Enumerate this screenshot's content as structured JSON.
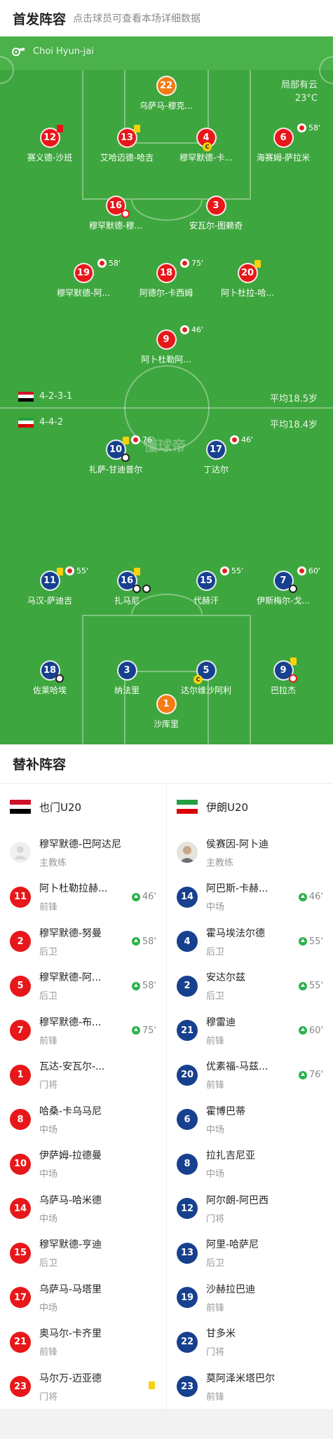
{
  "header": {
    "title": "首发阵容",
    "subtitle": "点击球员可查看本场详细数据"
  },
  "referee": {
    "name": "Choi Hyun-jai",
    "icon": "whistle-icon"
  },
  "weather": {
    "condition": "局部有云",
    "temperature": "23°C"
  },
  "watermark": "懂球帝",
  "home": {
    "name": "也门U20",
    "formation": "4-2-3-1",
    "avg_age": "平均18.5岁",
    "flag_colors": [
      "#ce1126",
      "#ffffff",
      "#000000"
    ],
    "players": [
      {
        "num": "22",
        "name": "乌萨马-穆克...",
        "color": "orange"
      },
      {
        "num": "12",
        "name": "赛义德-沙班"
      },
      {
        "num": "13",
        "name": "艾哈迈德-哈吉"
      },
      {
        "num": "4",
        "name": "穆罕默德-卡..."
      },
      {
        "num": "6",
        "name": "海赛姆-萨拉米",
        "sub_out": "58'"
      },
      {
        "num": "16",
        "name": "穆罕默德-穆..."
      },
      {
        "num": "3",
        "name": "安瓦尔-图赖奇"
      },
      {
        "num": "19",
        "name": "穆罕默德-阿...",
        "sub_out": "58'"
      },
      {
        "num": "18",
        "name": "阿德尔-卡西姆",
        "sub_out": "75'"
      },
      {
        "num": "20",
        "name": "阿卜杜拉-哈..."
      },
      {
        "num": "9",
        "name": "阿卜杜勒阿...",
        "sub_out": "46'"
      }
    ]
  },
  "away": {
    "name": "伊朗U20",
    "formation": "4-4-2",
    "avg_age": "平均18.4岁",
    "flag_colors": [
      "#239f40",
      "#ffffff",
      "#da0000"
    ],
    "players": [
      {
        "num": "10",
        "name": "礼萨-甘迪普尔",
        "sub_out": "76'"
      },
      {
        "num": "17",
        "name": "丁达尔",
        "sub_out": "46'"
      },
      {
        "num": "11",
        "name": "马汉-萨迪吉",
        "sub_out": "55'"
      },
      {
        "num": "16",
        "name": "扎马尼"
      },
      {
        "num": "15",
        "name": "代赫汗",
        "sub_out": "55'"
      },
      {
        "num": "7",
        "name": "伊斯梅尔-戈...",
        "sub_out": "60'"
      },
      {
        "num": "18",
        "name": "佐莱哈埃"
      },
      {
        "num": "3",
        "name": "纳法里"
      },
      {
        "num": "5",
        "name": "达尔维沙阿利"
      },
      {
        "num": "9",
        "name": "巴拉杰"
      },
      {
        "num": "1",
        "name": "沙库里",
        "color": "orange"
      }
    ]
  },
  "subs": {
    "title": "替补阵容",
    "home": {
      "team": "也门U20",
      "coach": {
        "name": "穆罕默德-巴阿达尼",
        "role": "主教练"
      },
      "players": [
        {
          "num": "11",
          "name": "阿卜杜勒拉赫...",
          "pos": "前锋",
          "in": "46'"
        },
        {
          "num": "2",
          "name": "穆罕默德-努曼",
          "pos": "后卫",
          "in": "58'"
        },
        {
          "num": "5",
          "name": "穆罕默德-阿...",
          "pos": "后卫",
          "in": "58'"
        },
        {
          "num": "7",
          "name": "穆罕默德-布...",
          "pos": "前锋",
          "in": "75'"
        },
        {
          "num": "1",
          "name": "瓦达-安瓦尔-...",
          "pos": "门将"
        },
        {
          "num": "8",
          "name": "哈桑-卡乌马尼",
          "pos": "中场"
        },
        {
          "num": "10",
          "name": "伊萨姆-拉德曼",
          "pos": "中场"
        },
        {
          "num": "14",
          "name": "乌萨马-哈米德",
          "pos": "中场"
        },
        {
          "num": "15",
          "name": "穆罕默德-亨迪",
          "pos": "后卫"
        },
        {
          "num": "17",
          "name": "乌萨马-马塔里",
          "pos": "中场"
        },
        {
          "num": "21",
          "name": "奥马尔-卡齐里",
          "pos": "前锋"
        },
        {
          "num": "23",
          "name": "马尔万-迈亚德",
          "pos": "门将",
          "card": "yellow"
        }
      ]
    },
    "away": {
      "team": "伊朗U20",
      "coach": {
        "name": "侯赛因-阿卜迪",
        "role": "主教练"
      },
      "players": [
        {
          "num": "14",
          "name": "阿巴斯-卡赫...",
          "pos": "中场",
          "in": "46'"
        },
        {
          "num": "4",
          "name": "霍马埃法尔德",
          "pos": "后卫",
          "in": "55'"
        },
        {
          "num": "2",
          "name": "安达尔兹",
          "pos": "后卫",
          "in": "55'"
        },
        {
          "num": "21",
          "name": "穆雷迪",
          "pos": "前锋",
          "in": "60'"
        },
        {
          "num": "20",
          "name": "优素福-马兹...",
          "pos": "前锋",
          "in": "76'"
        },
        {
          "num": "6",
          "name": "霍博巴蒂",
          "pos": "中场"
        },
        {
          "num": "8",
          "name": "拉扎吉尼亚",
          "pos": "中场"
        },
        {
          "num": "12",
          "name": "阿尔朗-阿巴西",
          "pos": "门将"
        },
        {
          "num": "13",
          "name": "阿里-哈萨尼",
          "pos": "后卫"
        },
        {
          "num": "19",
          "name": "沙赫拉巴迪",
          "pos": "前锋"
        },
        {
          "num": "22",
          "name": "甘多米",
          "pos": "门将"
        },
        {
          "num": "23",
          "name": "莫阿泽米塔巴尔",
          "pos": "前锋"
        }
      ]
    }
  }
}
